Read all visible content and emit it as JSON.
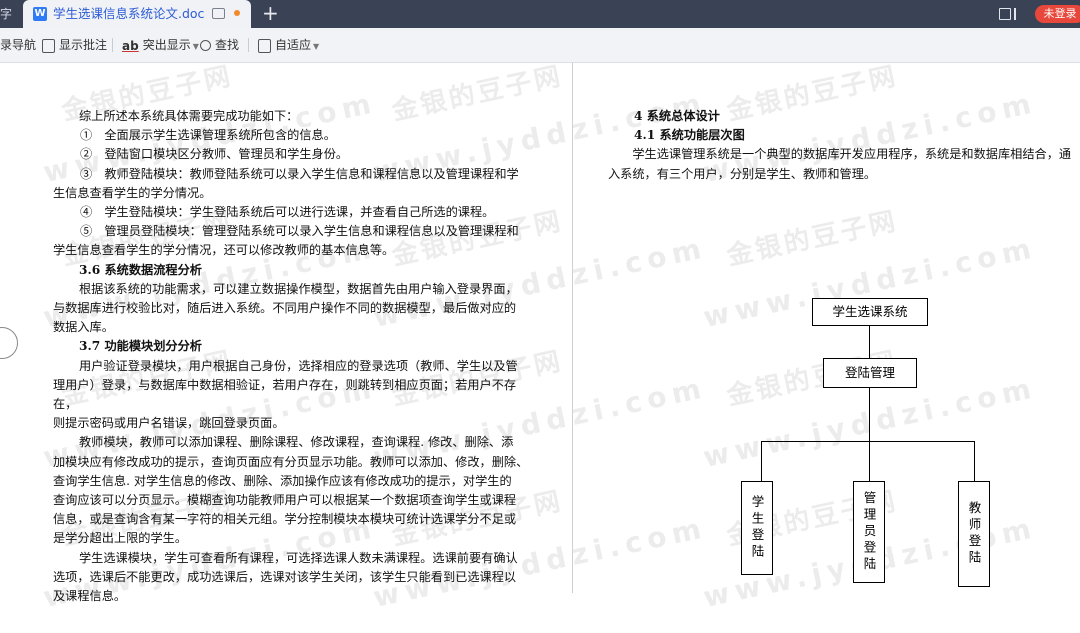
{
  "tabbar": {
    "left_stub": "字",
    "doc_icon": "W",
    "doc_title": "学生选课信息系统论文.doc",
    "new_tab": "+",
    "login": "未登录"
  },
  "toolbar": {
    "nav": "录导航",
    "comments": "显示批注",
    "highlight": "突出显示",
    "find": "查找",
    "autofit": "自适应"
  },
  "left_page": [
    {
      "t": "ind",
      "text": "综上所述本系统具体需要完成功能如下："
    },
    {
      "t": "li",
      "text": "①　全面展示学生选课管理系统所包含的信息。"
    },
    {
      "t": "li",
      "text": "②　登陆窗口模块区分教师、管理员和学生身份。"
    },
    {
      "t": "li",
      "text": "③　教师登陆模块：教师登陆系统可以录入学生信息和课程信息以及管理课程和学"
    },
    {
      "t": "p",
      "text": "生信息查看学生的学分情况。"
    },
    {
      "t": "li",
      "text": "④　学生登陆模块：学生登陆系统后可以进行选课，并查看自己所选的课程。"
    },
    {
      "t": "li",
      "text": "⑤　管理员登陆模块：管理登陆系统可以录入学生信息和课程信息以及管理课程和"
    },
    {
      "t": "p",
      "text": "学生信息查看学生的学分情况，还可以修改教师的基本信息等。"
    },
    {
      "t": "hd",
      "text": "3.6 系统数据流程分析"
    },
    {
      "t": "ind",
      "text": "根据该系统的功能需求，可以建立数据操作模型，数据首先由用户输入登录界面，"
    },
    {
      "t": "p",
      "text": "与数据库进行校验比对，随后进入系统。不同用户操作不同的数据模型，最后做对应的"
    },
    {
      "t": "p",
      "text": "数据入库。"
    },
    {
      "t": "hd",
      "text": "3.7 功能模块划分分析"
    },
    {
      "t": "ind",
      "text": "用户验证登录模块，用户根据自己身份，选择相应的登录选项（教师、学生以及管"
    },
    {
      "t": "p",
      "text": "理用户）登录，与数据库中数据相验证，若用户存在，则跳转到相应页面；若用户不存在，"
    },
    {
      "t": "p",
      "text": "则提示密码或用户名错误，跳回登录页面。"
    },
    {
      "t": "ind",
      "text": "教师模块，教师可以添加课程、删除课程、修改课程，查询课程. 修改、删除、添"
    },
    {
      "t": "p",
      "text": "加模块应有修改成功的提示，查询页面应有分页显示功能。教师可以添加、修改，删除、"
    },
    {
      "t": "p",
      "text": "查询学生信息. 对学生信息的修改、删除、添加操作应该有修改成功的提示，对学生的"
    },
    {
      "t": "p",
      "text": "查询应该可以分页显示。模糊查询功能教师用户可以根据某一个数据项查询学生或课程"
    },
    {
      "t": "p",
      "text": "信息，或是查询含有某一字符的相关元组。学分控制模块本模块可统计选课学分不足或"
    },
    {
      "t": "p",
      "text": "是学分超出上限的学生。"
    },
    {
      "t": "ind",
      "text": "学生选课模块，学生可查看所有课程，可选择选课人数未满课程。选课前要有确认"
    },
    {
      "t": "p",
      "text": "选项，选课后不能更改，成功选课后，选课对该学生关闭，该学生只能看到已选课程以"
    },
    {
      "t": "p",
      "text": "及课程信息。"
    }
  ],
  "right_page": {
    "h1": "4 系统总体设计",
    "h2": "4.1 系统功能层次图",
    "p1": "　　学生选课管理系统是一个典型的数据库开发应用程序，系统是和数据库相结合，通",
    "p2": "入系统，有三个用户，分别是学生、教师和管理。"
  },
  "diagram": {
    "root": "学生选课系统",
    "mid": "登陆管理",
    "leaf1": "学生登陆",
    "leaf2": "管理员登陆",
    "leaf3": "教师登陆"
  },
  "watermark": {
    "cn": "金银的豆子网",
    "url": "www.jyddzi.com"
  }
}
